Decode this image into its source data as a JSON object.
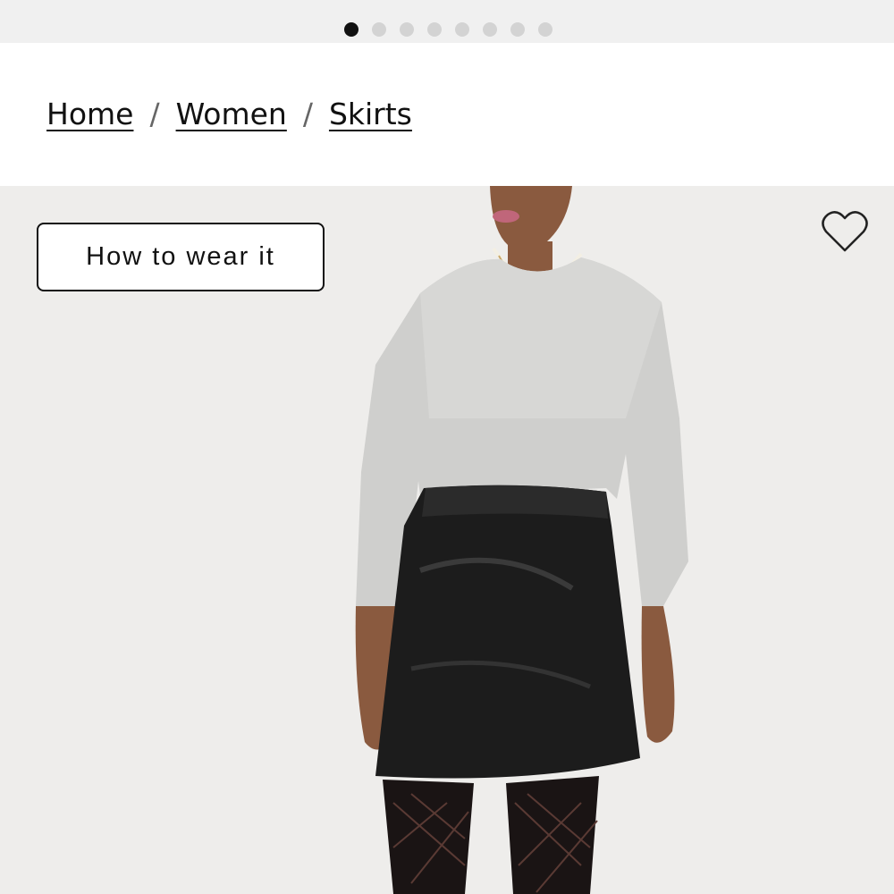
{
  "carousel": {
    "count": 8,
    "active_index": 0
  },
  "breadcrumb": {
    "items": [
      "Home",
      "Women",
      "Skirts"
    ],
    "separator": "/"
  },
  "hero": {
    "how_to_wear_label": "How to wear it",
    "wishlist_icon": "heart-outline-icon"
  },
  "colors": {
    "top_strip": "#f0f0f0",
    "dot_active": "#111111",
    "dot_inactive": "#d3d3d3",
    "hero_bg": "#eeedeb"
  }
}
